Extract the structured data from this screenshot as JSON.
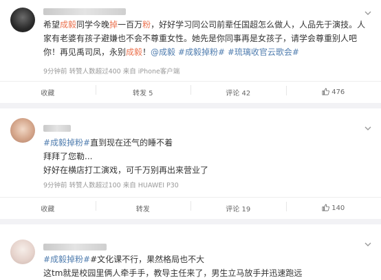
{
  "posts": [
    {
      "parts": [
        {
          "t": "希望"
        },
        {
          "t": "成毅",
          "c": "link"
        },
        {
          "t": "同学今晚"
        },
        {
          "t": "掉",
          "c": "link"
        },
        {
          "t": "一百万"
        },
        {
          "t": "粉",
          "c": "link"
        },
        {
          "t": "，好好学习同公司前辈任国超怎么做人，人品先于演技。人家有老婆有孩子避嫌也不会不尊重女性。她先是你同事再是女孩子，请学会尊重别人吧你！再见禹司凤，永别"
        },
        {
          "t": "成毅",
          "c": "link"
        },
        {
          "t": "！"
        },
        {
          "t": "@成毅",
          "c": "tag"
        },
        {
          "t": " "
        },
        {
          "t": "#成毅掉粉#",
          "c": "tag"
        },
        {
          "t": " "
        },
        {
          "t": "#琉璃收官云歌会#",
          "c": "tag"
        }
      ],
      "meta": "9分钟前  转赞人数超过400  来自 iPhone客户端",
      "actions": {
        "fav": "收藏",
        "repost": "转发 5",
        "comment": "评论 42",
        "like": "476"
      }
    },
    {
      "lines": [
        [
          {
            "t": "#成毅掉粉#",
            "c": "tag"
          },
          {
            "t": "直到现在还气的睡不着"
          }
        ],
        [
          {
            "t": "拜拜了您勒..."
          }
        ],
        [
          {
            "t": "好好在横店打工演戏，可千万别再出来营业了"
          }
        ]
      ],
      "meta": "9分钟前  转赞人数超过100  来自 HUAWEI P30",
      "actions": {
        "fav": "收藏",
        "repost": "转发",
        "comment": "评论 19",
        "like": "140"
      }
    },
    {
      "lines": [
        [
          {
            "t": "#成毅掉粉#",
            "c": "tag"
          },
          {
            "t": "#文化课不行，果然格局也不大"
          }
        ],
        [
          {
            "t": "这tm就是校园里俩人牵手手，教导主任来了，男生立马放手并迅速跑远"
          }
        ]
      ]
    }
  ]
}
